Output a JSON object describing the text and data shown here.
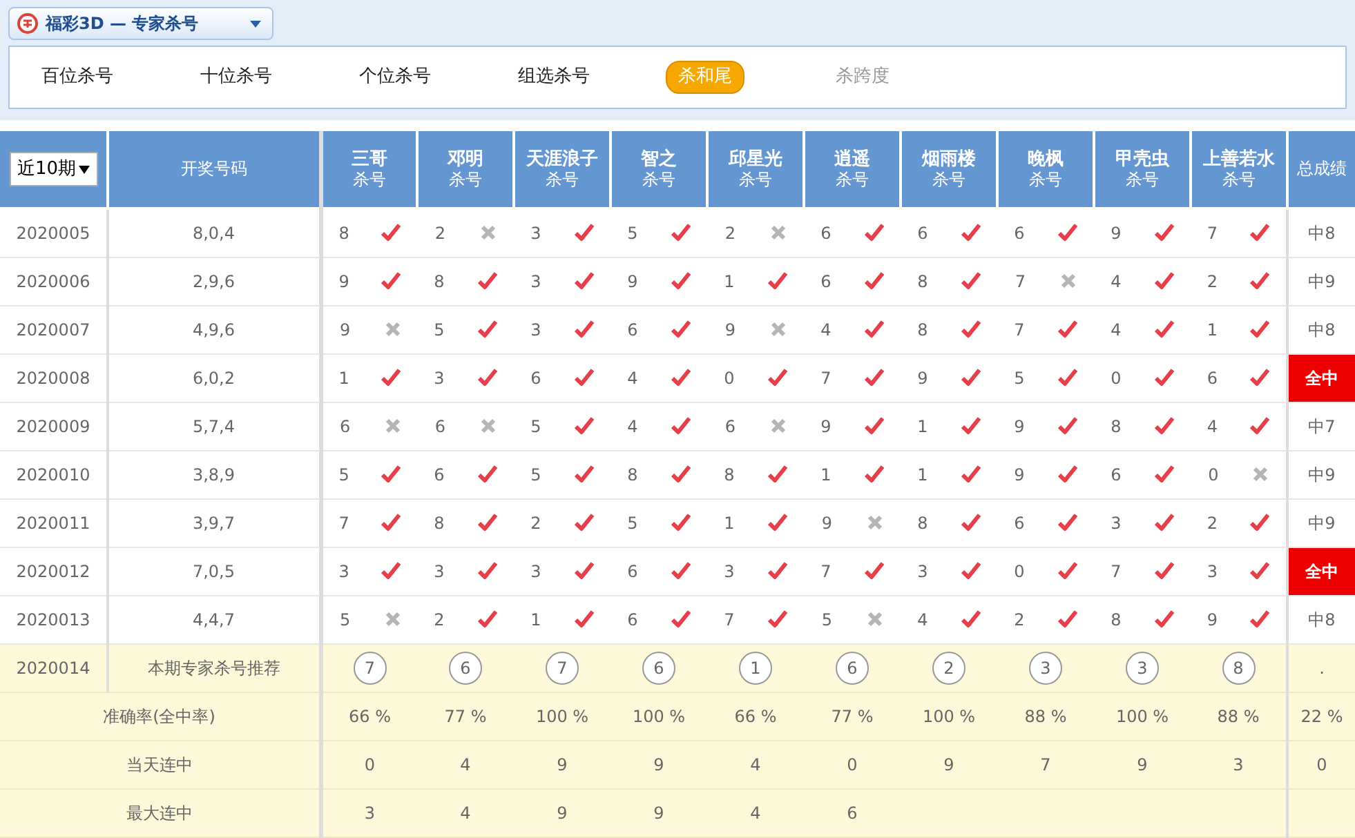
{
  "selector": {
    "title": "福彩3D — 专家杀号"
  },
  "tabs": [
    {
      "label": "百位杀号",
      "selected": false,
      "disabled": false
    },
    {
      "label": "十位杀号",
      "selected": false,
      "disabled": false
    },
    {
      "label": "个位杀号",
      "selected": false,
      "disabled": false
    },
    {
      "label": "组选杀号",
      "selected": false,
      "disabled": false
    },
    {
      "label": "杀和尾",
      "selected": true,
      "disabled": false
    },
    {
      "label": "杀跨度",
      "selected": false,
      "disabled": true
    }
  ],
  "table": {
    "period_filter": "近10期",
    "draw_heading": "开奖号码",
    "total_heading": "总成绩",
    "experts": [
      {
        "name": "三哥",
        "label": "杀号"
      },
      {
        "name": "邓明",
        "label": "杀号"
      },
      {
        "name": "天涯浪子",
        "label": "杀号"
      },
      {
        "name": "智之",
        "label": "杀号"
      },
      {
        "name": "邱星光",
        "label": "杀号"
      },
      {
        "name": "逍遥",
        "label": "杀号"
      },
      {
        "name": "烟雨楼",
        "label": "杀号"
      },
      {
        "name": "晚枫",
        "label": "杀号"
      },
      {
        "name": "甲壳虫",
        "label": "杀号"
      },
      {
        "name": "上善若水",
        "label": "杀号"
      }
    ],
    "rows": [
      {
        "period": "2020005",
        "draw": "8,0,4",
        "picks": [
          {
            "num": "8",
            "hit": true
          },
          {
            "num": "2",
            "hit": false
          },
          {
            "num": "3",
            "hit": true
          },
          {
            "num": "5",
            "hit": true
          },
          {
            "num": "2",
            "hit": false
          },
          {
            "num": "6",
            "hit": true
          },
          {
            "num": "6",
            "hit": true
          },
          {
            "num": "6",
            "hit": true
          },
          {
            "num": "9",
            "hit": true
          },
          {
            "num": "7",
            "hit": true
          }
        ],
        "total": "中8",
        "all_hit": false
      },
      {
        "period": "2020006",
        "draw": "2,9,6",
        "picks": [
          {
            "num": "9",
            "hit": true
          },
          {
            "num": "8",
            "hit": true
          },
          {
            "num": "3",
            "hit": true
          },
          {
            "num": "9",
            "hit": true
          },
          {
            "num": "1",
            "hit": true
          },
          {
            "num": "6",
            "hit": true
          },
          {
            "num": "8",
            "hit": true
          },
          {
            "num": "7",
            "hit": false
          },
          {
            "num": "4",
            "hit": true
          },
          {
            "num": "2",
            "hit": true
          }
        ],
        "total": "中9",
        "all_hit": false
      },
      {
        "period": "2020007",
        "draw": "4,9,6",
        "picks": [
          {
            "num": "9",
            "hit": false
          },
          {
            "num": "5",
            "hit": true
          },
          {
            "num": "3",
            "hit": true
          },
          {
            "num": "6",
            "hit": true
          },
          {
            "num": "9",
            "hit": false
          },
          {
            "num": "4",
            "hit": true
          },
          {
            "num": "8",
            "hit": true
          },
          {
            "num": "7",
            "hit": true
          },
          {
            "num": "4",
            "hit": true
          },
          {
            "num": "1",
            "hit": true
          }
        ],
        "total": "中8",
        "all_hit": false
      },
      {
        "period": "2020008",
        "draw": "6,0,2",
        "picks": [
          {
            "num": "1",
            "hit": true
          },
          {
            "num": "3",
            "hit": true
          },
          {
            "num": "6",
            "hit": true
          },
          {
            "num": "4",
            "hit": true
          },
          {
            "num": "0",
            "hit": true
          },
          {
            "num": "7",
            "hit": true
          },
          {
            "num": "9",
            "hit": true
          },
          {
            "num": "5",
            "hit": true
          },
          {
            "num": "0",
            "hit": true
          },
          {
            "num": "6",
            "hit": true
          }
        ],
        "total": "全中",
        "all_hit": true
      },
      {
        "period": "2020009",
        "draw": "5,7,4",
        "picks": [
          {
            "num": "6",
            "hit": false
          },
          {
            "num": "6",
            "hit": false
          },
          {
            "num": "5",
            "hit": true
          },
          {
            "num": "4",
            "hit": true
          },
          {
            "num": "6",
            "hit": false
          },
          {
            "num": "9",
            "hit": true
          },
          {
            "num": "1",
            "hit": true
          },
          {
            "num": "9",
            "hit": true
          },
          {
            "num": "8",
            "hit": true
          },
          {
            "num": "4",
            "hit": true
          }
        ],
        "total": "中7",
        "all_hit": false
      },
      {
        "period": "2020010",
        "draw": "3,8,9",
        "picks": [
          {
            "num": "5",
            "hit": true
          },
          {
            "num": "6",
            "hit": true
          },
          {
            "num": "5",
            "hit": true
          },
          {
            "num": "8",
            "hit": true
          },
          {
            "num": "8",
            "hit": true
          },
          {
            "num": "1",
            "hit": true
          },
          {
            "num": "1",
            "hit": true
          },
          {
            "num": "9",
            "hit": true
          },
          {
            "num": "6",
            "hit": true
          },
          {
            "num": "0",
            "hit": false
          }
        ],
        "total": "中9",
        "all_hit": false
      },
      {
        "period": "2020011",
        "draw": "3,9,7",
        "picks": [
          {
            "num": "7",
            "hit": true
          },
          {
            "num": "8",
            "hit": true
          },
          {
            "num": "2",
            "hit": true
          },
          {
            "num": "5",
            "hit": true
          },
          {
            "num": "1",
            "hit": true
          },
          {
            "num": "9",
            "hit": false
          },
          {
            "num": "8",
            "hit": true
          },
          {
            "num": "6",
            "hit": true
          },
          {
            "num": "3",
            "hit": true
          },
          {
            "num": "2",
            "hit": true
          }
        ],
        "total": "中9",
        "all_hit": false
      },
      {
        "period": "2020012",
        "draw": "7,0,5",
        "picks": [
          {
            "num": "3",
            "hit": true
          },
          {
            "num": "3",
            "hit": true
          },
          {
            "num": "3",
            "hit": true
          },
          {
            "num": "6",
            "hit": true
          },
          {
            "num": "3",
            "hit": true
          },
          {
            "num": "7",
            "hit": true
          },
          {
            "num": "3",
            "hit": true
          },
          {
            "num": "0",
            "hit": true
          },
          {
            "num": "7",
            "hit": true
          },
          {
            "num": "3",
            "hit": true
          }
        ],
        "total": "全中",
        "all_hit": true
      },
      {
        "period": "2020013",
        "draw": "4,4,7",
        "picks": [
          {
            "num": "5",
            "hit": false
          },
          {
            "num": "2",
            "hit": true
          },
          {
            "num": "1",
            "hit": true
          },
          {
            "num": "6",
            "hit": true
          },
          {
            "num": "7",
            "hit": true
          },
          {
            "num": "5",
            "hit": false
          },
          {
            "num": "4",
            "hit": true
          },
          {
            "num": "2",
            "hit": true
          },
          {
            "num": "8",
            "hit": true
          },
          {
            "num": "9",
            "hit": true
          }
        ],
        "total": "中8",
        "all_hit": false
      }
    ],
    "recommend": {
      "period": "2020014",
      "label": "本期专家杀号推荐",
      "picks": [
        "7",
        "6",
        "7",
        "6",
        "1",
        "6",
        "2",
        "3",
        "3",
        "8"
      ],
      "total": "."
    },
    "stats": [
      {
        "label": "准确率(全中率)",
        "values": [
          "66 %",
          "77 %",
          "100 %",
          "100 %",
          "66 %",
          "77 %",
          "100 %",
          "88 %",
          "100 %",
          "88 %"
        ],
        "total": "22 %"
      },
      {
        "label": "当天连中",
        "values": [
          "0",
          "4",
          "9",
          "9",
          "4",
          "0",
          "9",
          "7",
          "9",
          "3"
        ],
        "total": "0"
      },
      {
        "label": "最大连中",
        "values": [
          "3",
          "4",
          "9",
          "9",
          "4",
          "6"
        ]
      }
    ]
  }
}
